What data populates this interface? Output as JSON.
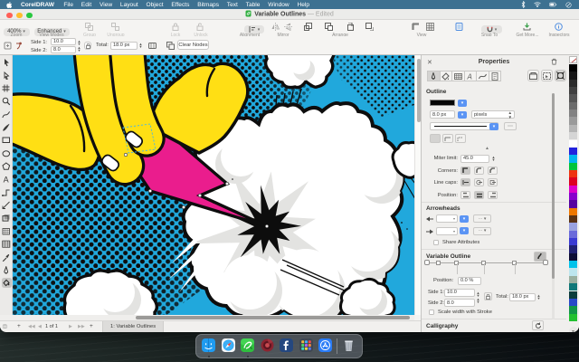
{
  "menu_bar": {
    "app_name": "CorelDRAW",
    "items": [
      "File",
      "Edit",
      "View",
      "Layout",
      "Object",
      "Effects",
      "Bitmaps",
      "Text",
      "Table",
      "Window",
      "Help"
    ],
    "status_icons": [
      "bluetooth-icon",
      "wifi-icon",
      "battery-icon",
      "clock-icon"
    ]
  },
  "window": {
    "title": "Variable Outlines",
    "title_suffix": "— Edited"
  },
  "toolbar": {
    "zoom": {
      "value": "400%",
      "label": "Zoom"
    },
    "view_modes": {
      "value": "Enhanced",
      "label": "View Modes"
    },
    "group_label": "Group",
    "ungroup_label": "Ungroup",
    "lock_label": "Lock",
    "unlock_label": "Unlock",
    "alignment_label": "Alignment",
    "mirror_label": "Mirror",
    "arrange_label": "Arrange",
    "view_label": "View",
    "snap_to_label": "Snap To",
    "get_more_label": "Get More...",
    "inspectors_label": "Inspectors"
  },
  "property_bar": {
    "side1_label": "Side 1:",
    "side1_value": "10.0",
    "side2_label": "Side 2:",
    "side2_value": "8.0",
    "total_label": "Total:",
    "total_value": "18.0 px",
    "clear_nodes_label": "Clear Nodes"
  },
  "toolbox": {
    "tools": [
      "pick",
      "shape",
      "crop",
      "zoom",
      "freehand",
      "artistic-media",
      "rectangle",
      "ellipse",
      "polygon",
      "text",
      "connector",
      "dimension",
      "drop-shadow",
      "transparency",
      "table",
      "eyedropper",
      "outline",
      "interactive-fill"
    ],
    "selected_tool": "interactive-fill"
  },
  "navigator": {
    "add_page": "+",
    "page_count": "1 of 1",
    "tab": "1: Variable Outlines"
  },
  "panel": {
    "title": "Properties",
    "outline": {
      "title": "Outline",
      "width_value": "8.0 px",
      "units_value": "pixels",
      "dots_label": "...",
      "miter_label": "Miter limit:",
      "miter_value": "45.0",
      "corners_label": "Corners:",
      "line_caps_label": "Line caps:",
      "position_label": "Position:"
    },
    "arrowheads": {
      "title": "Arrowheads",
      "share_label": "Share Attributes"
    },
    "variable_outline": {
      "title": "Variable Outline",
      "position_label": "Position:",
      "position_value": "0.0 %",
      "side1_label": "Side 1:",
      "side1_value": "10.0",
      "side2_label": "Side 2:",
      "side2_value": "8.0",
      "total_label": "Total:",
      "total_value": "18.0 px",
      "scale_label": "Scale width with Stroke"
    },
    "calligraphy": {
      "title": "Calligraphy"
    }
  },
  "palette": {
    "colors": [
      "#000000",
      "#161616",
      "#2b2b2b",
      "#404040",
      "#555555",
      "#6b6b6b",
      "#828282",
      "#9a9a9a",
      "#b5b5b5",
      "#d5d5d5",
      "#ffffff",
      "#2222dd",
      "#00b4ee",
      "#00c43a",
      "#ee3311",
      "#dd0022",
      "#dd00c8",
      "#8800cc",
      "#5500a0",
      "#ee7700",
      "#5a3214",
      "#9aa2e0",
      "#6a6ada",
      "#3a3ad2",
      "#202072",
      "#0d0d35",
      "#00c2ea",
      "#bde6ee",
      "#9ab0a0",
      "#107878",
      "#0a3c3c",
      "#2848c8",
      "#129648",
      "#22c030"
    ]
  },
  "dock": {
    "apps": [
      "finder",
      "safari",
      "coreldraw",
      "photo-paint",
      "facebook",
      "launchpad",
      "app-store"
    ],
    "trash": "trash",
    "running": [
      "finder",
      "coreldraw"
    ]
  },
  "artwork": {
    "background_color": "#21a8dc",
    "hand_color": "#ffdf14",
    "bolt_color": "#ea1d8d",
    "ink_color": "#0d0d0d",
    "cloud_color": "#ffffff",
    "shade_color": "#e3e3e1",
    "node_color": "#ffffff",
    "select_dash_color": "#45b6e8"
  }
}
